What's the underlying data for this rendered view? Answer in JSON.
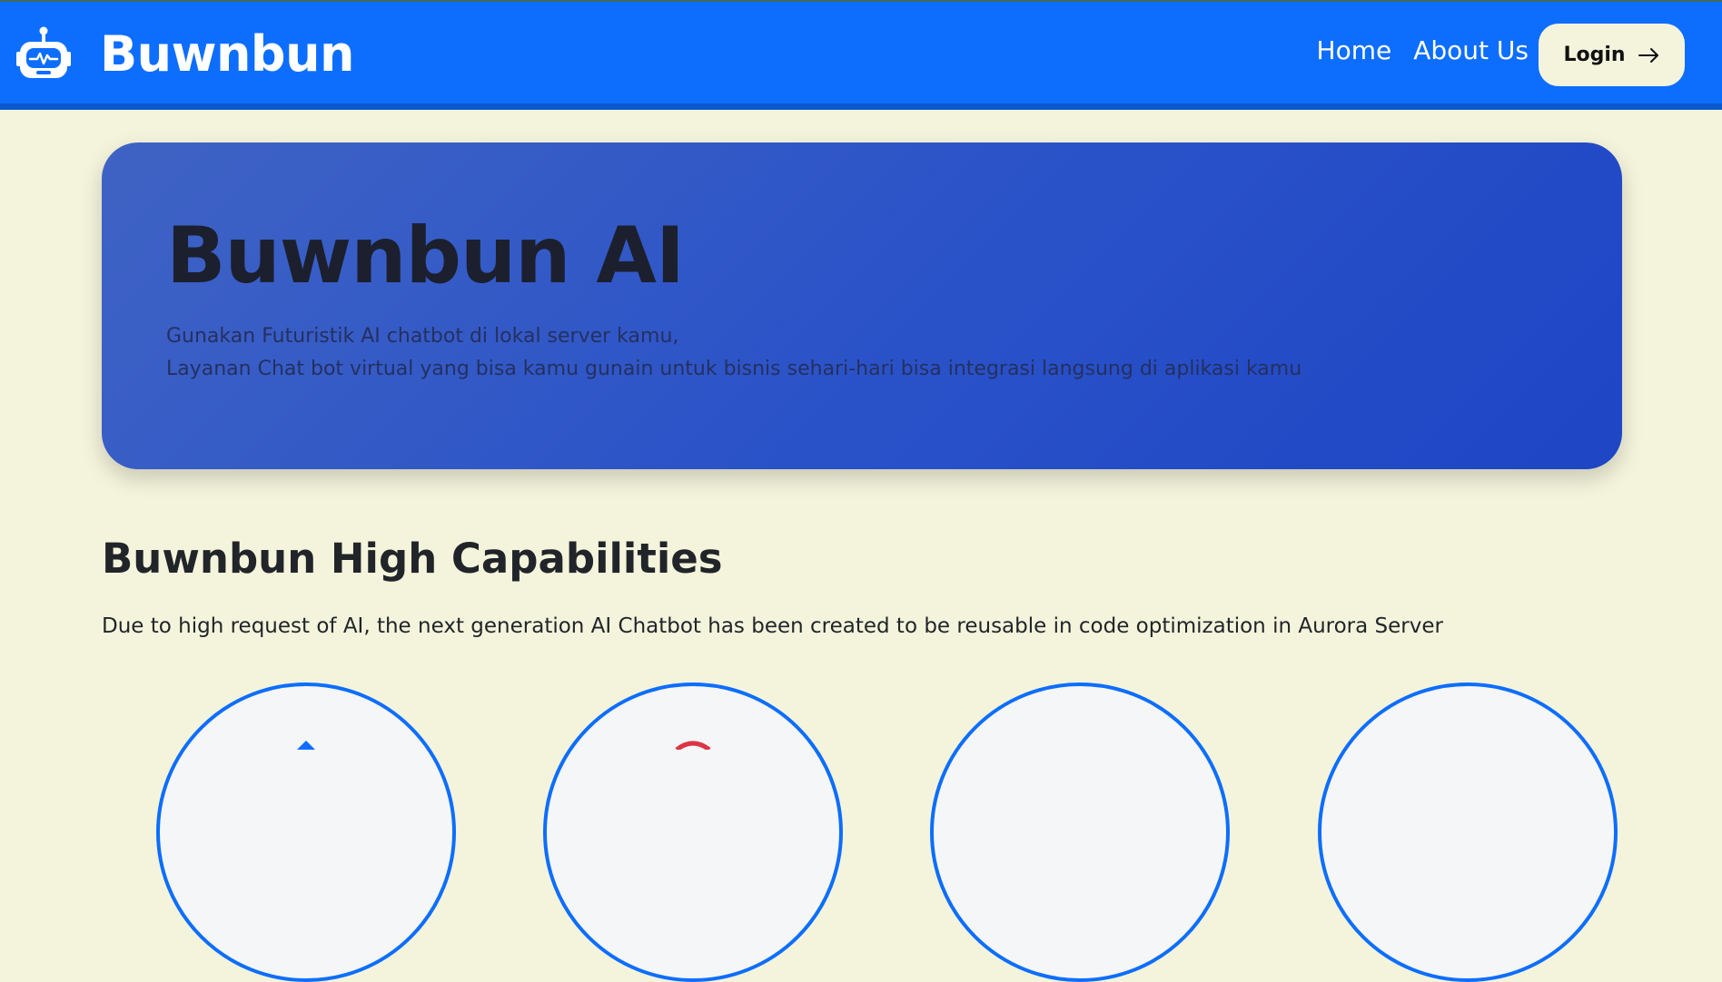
{
  "navbar": {
    "brand_name": "Buwnbun",
    "brand_icon": "robot-icon",
    "links": [
      {
        "label": "Home"
      },
      {
        "label": "About Us"
      }
    ],
    "login_label": "Login",
    "login_icon": "arrow-right-icon",
    "background_color": "#0d6efd"
  },
  "hero": {
    "title": "Buwnbun AI",
    "subtitle_line1": "Gunakan Futuristik AI chatbot di lokal server kamu,",
    "subtitle_line2": "Layanan Chat bot virtual yang bisa kamu gunain untuk bisnis sehari-hari bisa integrasi langsung di aplikasi kamu"
  },
  "capabilities": {
    "title": "Buwnbun High Capabilities",
    "description": "Due to high request of AI, the next generation AI Chatbot has been created to be reusable in code optimization in Aurora Server",
    "cards": [
      {
        "icon": "capability-icon-1",
        "accent": "#0d6efd"
      },
      {
        "icon": "capability-icon-2",
        "accent": "#dc3545"
      },
      {
        "icon": "capability-icon-3",
        "accent": "#0d6efd"
      },
      {
        "icon": "capability-icon-4",
        "accent": "#0d6efd"
      }
    ]
  },
  "page_background": "#f4f4dc"
}
